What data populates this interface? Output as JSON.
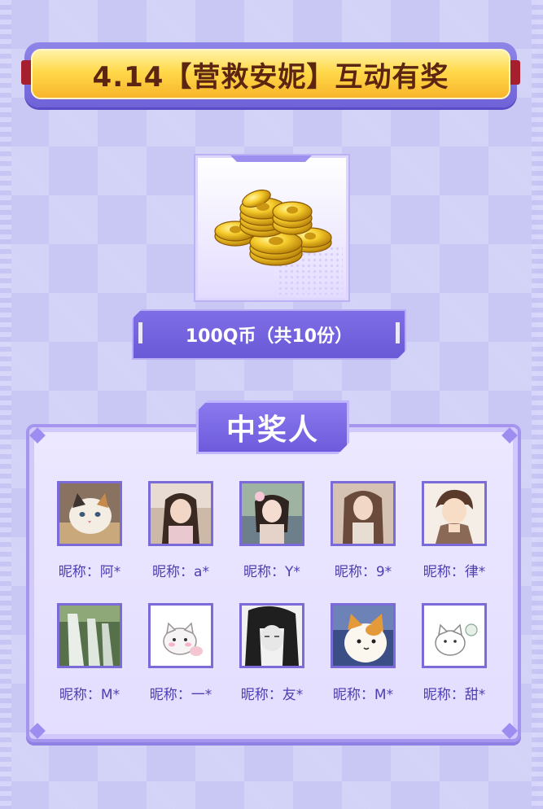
{
  "header": {
    "title": "4.14【营救安妮】互动有奖"
  },
  "prize": {
    "icon": "gold-coins-icon",
    "label": "100Q币（共10份）"
  },
  "winners": {
    "title": "中奖人",
    "list": [
      {
        "nickname": "昵称：阿*",
        "avatar": "cat-avatar"
      },
      {
        "nickname": "昵称：a*",
        "avatar": "girl-photo-avatar"
      },
      {
        "nickname": "昵称：Y*",
        "avatar": "girl-photo-avatar"
      },
      {
        "nickname": "昵称：9*",
        "avatar": "girl-photo-avatar"
      },
      {
        "nickname": "昵称：律*",
        "avatar": "anime-boy-avatar"
      },
      {
        "nickname": "昵称：M*",
        "avatar": "waterfall-avatar"
      },
      {
        "nickname": "昵称：一*",
        "avatar": "cartoon-cat-avatar"
      },
      {
        "nickname": "昵称：友*",
        "avatar": "sketch-girl-avatar"
      },
      {
        "nickname": "昵称：M*",
        "avatar": "cartoon-cat-avatar"
      },
      {
        "nickname": "昵称：甜*",
        "avatar": "cartoon-cat-avatar"
      }
    ]
  },
  "colors": {
    "accent": "#6d5bdc",
    "banner": "#ffd94a",
    "background": "#c9c8f5"
  }
}
